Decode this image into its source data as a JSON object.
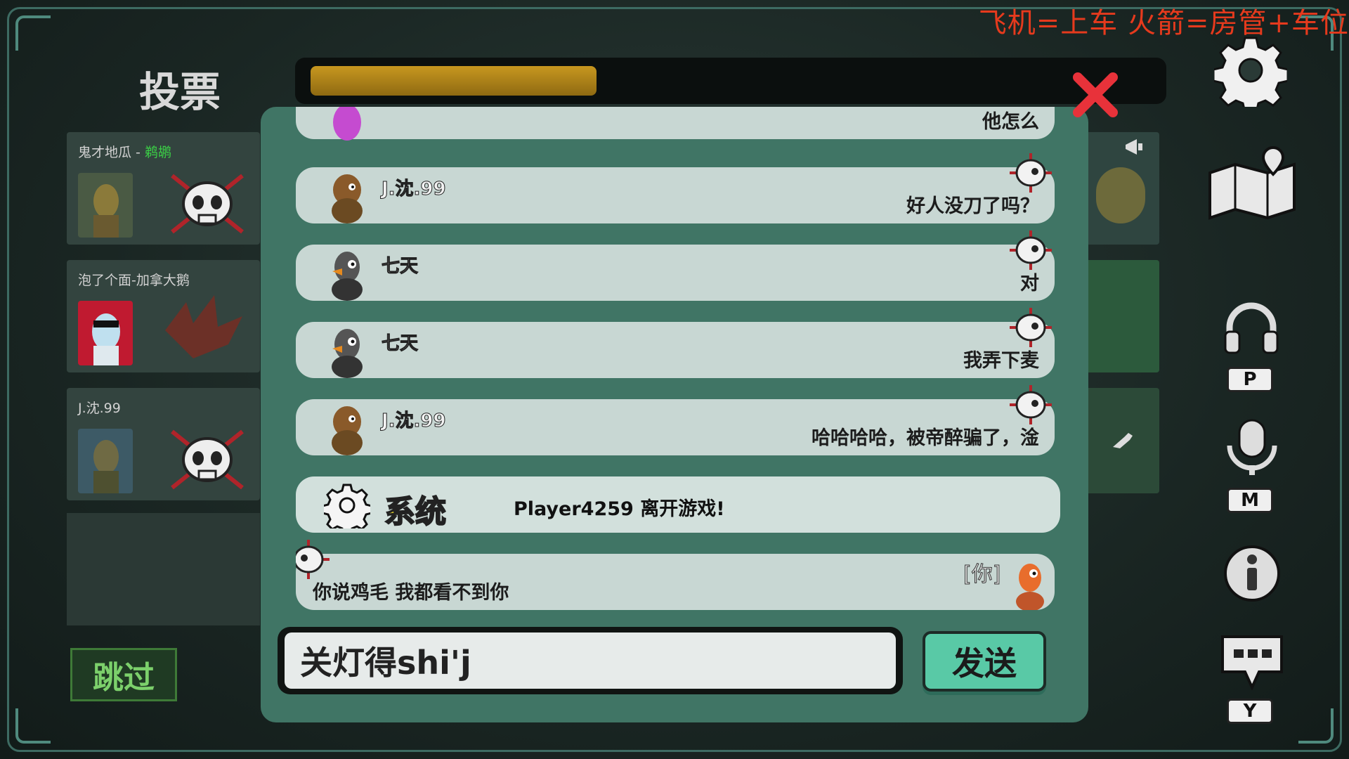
{
  "banner": "飞机=上车  火箭=房管+车位",
  "vote": {
    "title": "投票",
    "timer_fraction": 0.34,
    "skip_label": "跳过"
  },
  "players": [
    {
      "name": "鬼才地瓜 - ",
      "role": "鹈鹕",
      "dead": true
    },
    {
      "name": "泡了个面-加拿大鹅",
      "role": "",
      "dead": false
    },
    {
      "name": "J.沈.99",
      "role": "",
      "dead": true
    }
  ],
  "chat": {
    "messages": [
      {
        "sender": "",
        "text": "他怎么",
        "avatar": "pink-goose"
      },
      {
        "sender": "J.沈.99",
        "text": "好人没刀了吗？",
        "avatar": "bearded-goose"
      },
      {
        "sender": "七天",
        "text": "对",
        "avatar": "grey-goose"
      },
      {
        "sender": "七天",
        "text": "我弄下麦",
        "avatar": "grey-goose"
      },
      {
        "sender": "J.沈.99",
        "text": "哈哈哈哈，被帝醉骗了，淦",
        "avatar": "bearded-goose"
      }
    ],
    "system": {
      "label": "系统",
      "text": "Player4259 离开游戏!"
    },
    "own_message": {
      "you_tag": "[你]",
      "text": "你说鸡毛 我都看不到你"
    },
    "input_value": "关灯得shi'j",
    "send_label": "发送"
  },
  "toolbar": {
    "voice_key": "P",
    "mic_key": "M",
    "chat_key": "Y"
  },
  "colors": {
    "panel": "#407565",
    "timer": "#c7971f",
    "close": "#e8323a",
    "send": "#59c9a6",
    "system_label": "#e3d22b"
  }
}
